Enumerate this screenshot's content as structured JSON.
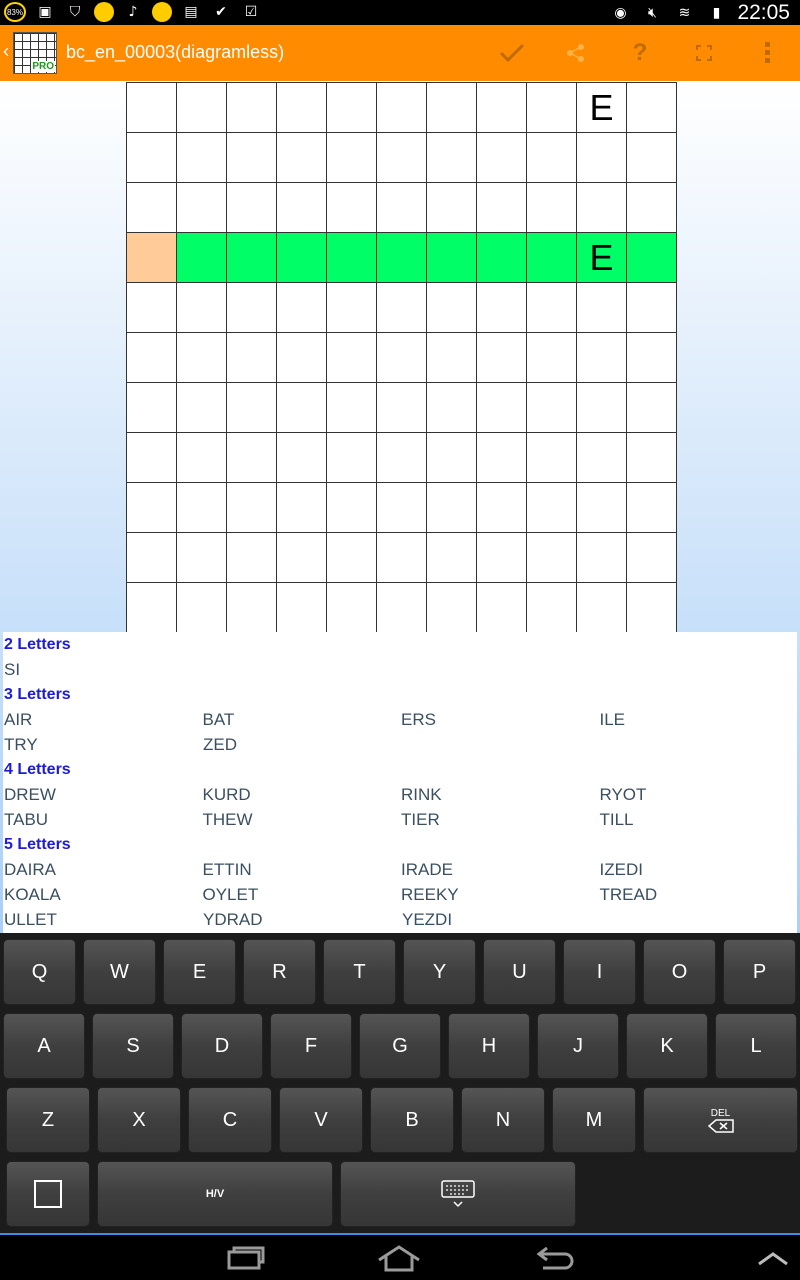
{
  "status_bar": {
    "battery_badge": "83%",
    "clock": "22:05"
  },
  "action_bar": {
    "title": "bc_en_00003(diagramless)",
    "icon_badge": "PRO"
  },
  "grid": {
    "size": 11,
    "highlight_row": 3,
    "current_cell": [
      3,
      0
    ],
    "letters": [
      {
        "row": 0,
        "col": 9,
        "value": "E"
      },
      {
        "row": 3,
        "col": 9,
        "value": "E"
      }
    ],
    "colors": {
      "highlight": "#00ff66",
      "current": "#ffcc99"
    }
  },
  "word_list": [
    {
      "heading": "2 Letters",
      "rows": [
        [
          "SI"
        ]
      ]
    },
    {
      "heading": "3 Letters",
      "rows": [
        [
          "AIR",
          "BAT",
          "ERS",
          "ILE"
        ],
        [
          "TRY",
          "ZED"
        ]
      ]
    },
    {
      "heading": "4 Letters",
      "rows": [
        [
          "DREW",
          "KURD",
          "RINK",
          "RYOT"
        ],
        [
          "TABU",
          "THEW",
          "TIER",
          "TILL"
        ]
      ]
    },
    {
      "heading": "5 Letters",
      "rows": [
        [
          "DAIRA",
          "ETTIN",
          "IRADE",
          "IZEDI"
        ],
        [
          "KOALA",
          "OYLET",
          "REEKY",
          "TREAD"
        ],
        [
          "ULLET",
          "YDRAD",
          "YEZDI"
        ]
      ]
    }
  ],
  "keyboard": {
    "row1": [
      "Q",
      "W",
      "E",
      "R",
      "T",
      "Y",
      "U",
      "I",
      "O",
      "P"
    ],
    "row2": [
      "A",
      "S",
      "D",
      "F",
      "G",
      "H",
      "J",
      "K",
      "L"
    ],
    "row3": [
      "Z",
      "X",
      "C",
      "V",
      "B",
      "N",
      "M"
    ],
    "delete_label": "DEL",
    "hv_label": "H/V"
  },
  "colors": {
    "action_bar": "#ff8c00",
    "heading_text": "#1c1cd6"
  }
}
